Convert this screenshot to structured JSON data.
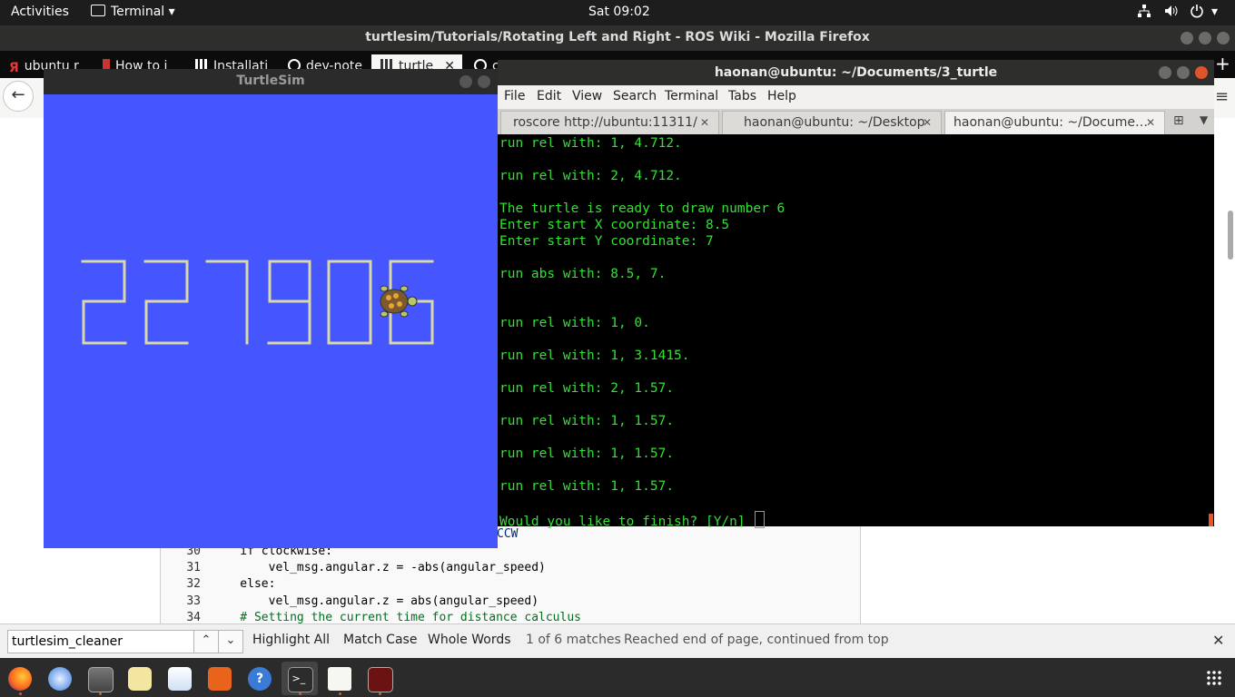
{
  "topbar": {
    "activities": "Activities",
    "app_menu": "Terminal",
    "clock": "Sat 09:02"
  },
  "firefox": {
    "window_title": "turtlesim/Tutorials/Rotating Left and Right - ROS Wiki - Mozilla Firefox",
    "tabs": [
      {
        "label": "ubuntu r"
      },
      {
        "label": "How to i"
      },
      {
        "label": "Installati"
      },
      {
        "label": "dev-note"
      },
      {
        "label": "turtle"
      },
      {
        "label": "c"
      }
    ]
  },
  "code": {
    "lines": [
      {
        "num": "30",
        "text": "    if clockwise:"
      },
      {
        "num": "31",
        "text": "        vel_msg.angular.z = -abs(angular_speed)"
      },
      {
        "num": "32",
        "text": "    else:"
      },
      {
        "num": "33",
        "text": "        vel_msg.angular.z = abs(angular_speed)"
      },
      {
        "num": "34",
        "text": "    # Setting the current time for distance calculus"
      }
    ],
    "ccw_fragment": "CCW"
  },
  "findbar": {
    "query": "turtlesim_cleaner",
    "highlight_all": "Highlight All",
    "match_case": "Match Case",
    "whole_words": "Whole Words",
    "match_count": "1 of 6 matches",
    "status": "Reached end of page, continued from top"
  },
  "turtlesim": {
    "title": "TurtleSim",
    "drawn_number": "227906",
    "background_color": "#4556ff",
    "pen_color": "#d8d8a8"
  },
  "terminal": {
    "title": "haonan@ubuntu: ~/Documents/3_turtle",
    "menu": [
      "File",
      "Edit",
      "View",
      "Search",
      "Terminal",
      "Tabs",
      "Help"
    ],
    "tabs": [
      {
        "label": "roscore http://ubuntu:11311/"
      },
      {
        "label": "haonan@ubuntu: ~/Desktop"
      },
      {
        "label": "haonan@ubuntu: ~/Docume…"
      }
    ],
    "lines": [
      "run rel with: 1, 4.712.",
      "",
      "run rel with: 2, 4.712.",
      "",
      "The turtle is ready to draw number 6",
      "Enter start X coordinate: 8.5",
      "Enter start Y coordinate: 7",
      "",
      "run abs with: 8.5, 7.",
      "",
      "",
      "run rel with: 1, 0.",
      "",
      "run rel with: 1, 3.1415.",
      "",
      "run rel with: 2, 1.57.",
      "",
      "run rel with: 1, 1.57.",
      "",
      "run rel with: 1, 1.57.",
      "",
      "run rel with: 1, 1.57.",
      "",
      "Would you like to finish? [Y/n] "
    ],
    "text_color": "#33e033"
  }
}
